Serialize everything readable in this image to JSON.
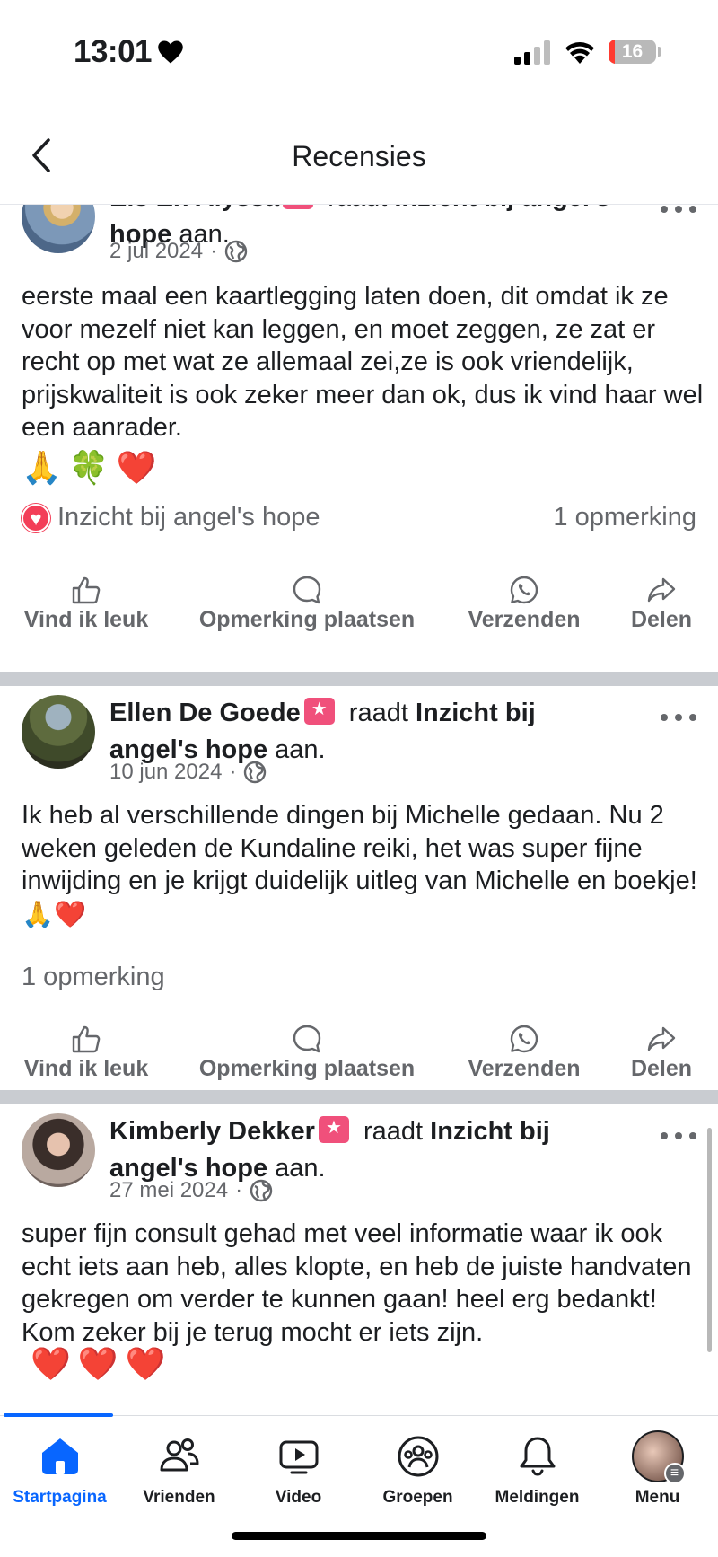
{
  "status": {
    "time": "13:01",
    "battery": "16"
  },
  "header": {
    "title": "Recensies"
  },
  "posts": [
    {
      "author": "Els En Alyssa",
      "verb": "raadt",
      "page": "Inzicht bij angel's",
      "page2": "hope",
      "suffix": "aan.",
      "date": "2 jul 2024",
      "sep": "·",
      "text": "eerste maal een kaartlegging laten doen, dit omdat ik ze voor mezelf niet kan leggen, en moet zeggen, ze zat er recht op met wat ze allemaal zei,ze is ook vriendelijk, prijskwaliteit is ook zeker meer dan ok, dus ik vind haar wel een aanrader.",
      "emojis": [
        "🙏",
        "🍀",
        "❤️"
      ],
      "reaction_label": "Inzicht bij angel's hope",
      "comments": "1 opmerking"
    },
    {
      "author": "Ellen De Goede",
      "verb": "raadt",
      "page": "Inzicht bij",
      "page2": "angel's hope",
      "suffix": "aan.",
      "date": "10 jun 2024",
      "sep": "·",
      "text": "Ik heb al verschillende dingen bij Michelle gedaan. Nu 2 weken geleden de Kundaline reiki, het was super fijne inwijding en je krijgt duidelijk uitleg van Michelle en boekje!",
      "emojis": [
        "🙏",
        "❤️"
      ],
      "comments": "1 opmerking"
    },
    {
      "author": "Kimberly Dekker",
      "verb": "raadt",
      "page": "Inzicht bij",
      "page2": "angel's hope",
      "suffix": "aan.",
      "date": "27 mei 2024",
      "sep": "·",
      "text": "super fijn consult gehad met veel informatie waar ik ook echt iets aan heb,  alles klopte, en heb de juiste handvaten gekregen om verder te kunnen gaan!  heel erg bedankt!  Kom zeker bij je terug mocht er iets zijn.",
      "emojis": [
        "❤️",
        "❤️",
        "❤️"
      ]
    }
  ],
  "actions": {
    "like": "Vind ik leuk",
    "comment": "Opmerking plaatsen",
    "send": "Verzenden",
    "share": "Delen"
  },
  "nav": {
    "home": "Startpagina",
    "friends": "Vrienden",
    "video": "Video",
    "groups": "Groepen",
    "notifications": "Meldingen",
    "menu": "Menu"
  },
  "colors": {
    "accent": "#0866ff",
    "recommend_badge": "#f0507b",
    "love": "#f33e58"
  }
}
